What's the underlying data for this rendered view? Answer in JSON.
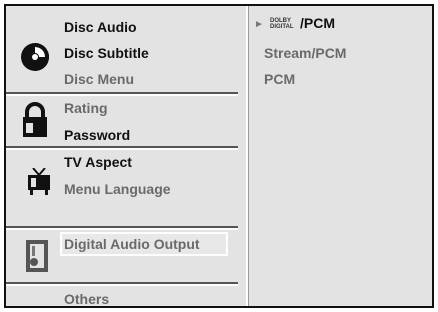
{
  "menu": {
    "left_items": [
      "Disc Audio",
      "Disc Subtitle",
      "Disc Menu",
      "Rating",
      "Password",
      "TV Aspect",
      "Menu Language",
      "Digital Audio Output",
      "Others"
    ],
    "right_items": {
      "dolby_logo_top": "DOLBY",
      "dolby_logo_bottom": "DIGITAL",
      "option1_suffix": "/PCM",
      "option2": "Stream/PCM",
      "option3": "PCM"
    },
    "icons": [
      "disc-icon",
      "lock-icon",
      "tv-icon",
      "speaker-icon"
    ],
    "cursor_symbol": "►"
  }
}
